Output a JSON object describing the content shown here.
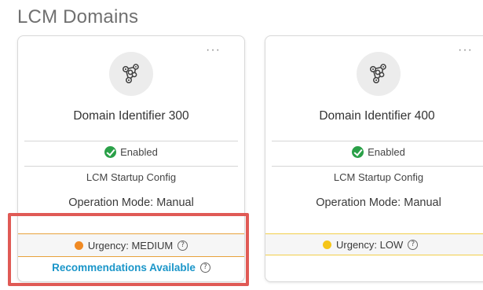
{
  "section_title": "LCM Domains",
  "colors": {
    "enabled": "#2aa048",
    "urgency_medium": "#f08a24",
    "urgency_low": "#f5c518",
    "link": "#1b96c9",
    "highlight": "#e05a55"
  },
  "cards": [
    {
      "menu_label": "···",
      "icon": "domain-nodes-icon",
      "title": "Domain Identifier 300",
      "status": "Enabled",
      "config": "LCM Startup Config",
      "mode": "Operation Mode: Manual",
      "urgency": "Urgency: MEDIUM",
      "help": "?",
      "recommendations": "Recommendations Available",
      "reco_help": "?"
    },
    {
      "menu_label": "···",
      "icon": "domain-nodes-icon",
      "title": "Domain Identifier 400",
      "status": "Enabled",
      "config": "LCM Startup Config",
      "mode": "Operation Mode: Manual",
      "urgency": "Urgency: LOW",
      "help": "?"
    }
  ]
}
